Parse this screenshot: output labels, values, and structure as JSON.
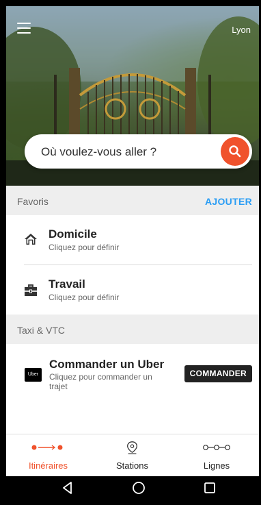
{
  "header": {
    "city": "Lyon"
  },
  "search": {
    "placeholder": "Où voulez-vous aller ?"
  },
  "favorites": {
    "title": "Favoris",
    "action_label": "AJOUTER",
    "items": [
      {
        "label": "Domicile",
        "sub": "Cliquez pour définir",
        "icon": "home-icon"
      },
      {
        "label": "Travail",
        "sub": "Cliquez pour définir",
        "icon": "briefcase-icon"
      }
    ]
  },
  "taxi": {
    "title": "Taxi & VTC",
    "logo_text": "Uber",
    "item_label": "Commander un Uber",
    "item_sub": "Cliquez pour commander un trajet",
    "button_label": "COMMANDER"
  },
  "bottom_nav": {
    "tabs": [
      {
        "label": "Itinéraires",
        "icon": "route-icon",
        "active": true
      },
      {
        "label": "Stations",
        "icon": "location-pin-icon",
        "active": false
      },
      {
        "label": "Lignes",
        "icon": "line-stops-icon",
        "active": false
      }
    ]
  },
  "colors": {
    "accent": "#f0522c",
    "link": "#2a9df4",
    "section_bg": "#eeeeee"
  }
}
